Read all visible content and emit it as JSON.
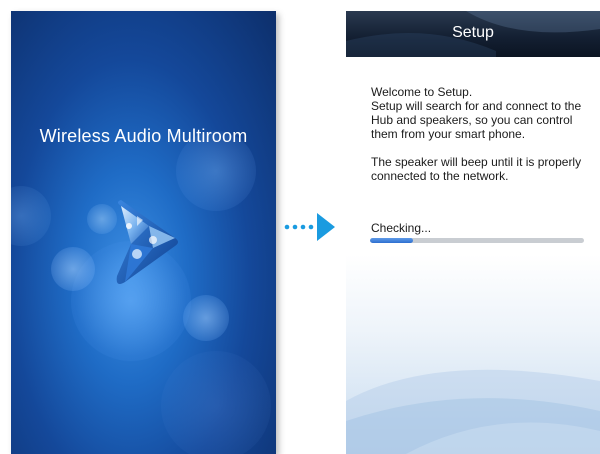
{
  "splash": {
    "title": "Wireless Audio Multiroom",
    "logo_icon": "play-triangle-logo-icon"
  },
  "transition": {
    "icon": "dotted-arrow-right-icon",
    "color": "#1a9be0"
  },
  "setup": {
    "title": "Setup",
    "paragraph1": "Welcome to Setup.\nSetup will search for and connect to the Hub and speakers, so you can control them from your smart phone.",
    "paragraph2": "The speaker will beep until it is properly connected to the network.",
    "status_label": "Checking...",
    "progress_fraction": 0.2
  },
  "colors": {
    "splash_blue": "#1f6cc6",
    "header_dark": "#142033",
    "progress_blue": "#2d6fd0",
    "progress_track": "#c9cdd2"
  }
}
